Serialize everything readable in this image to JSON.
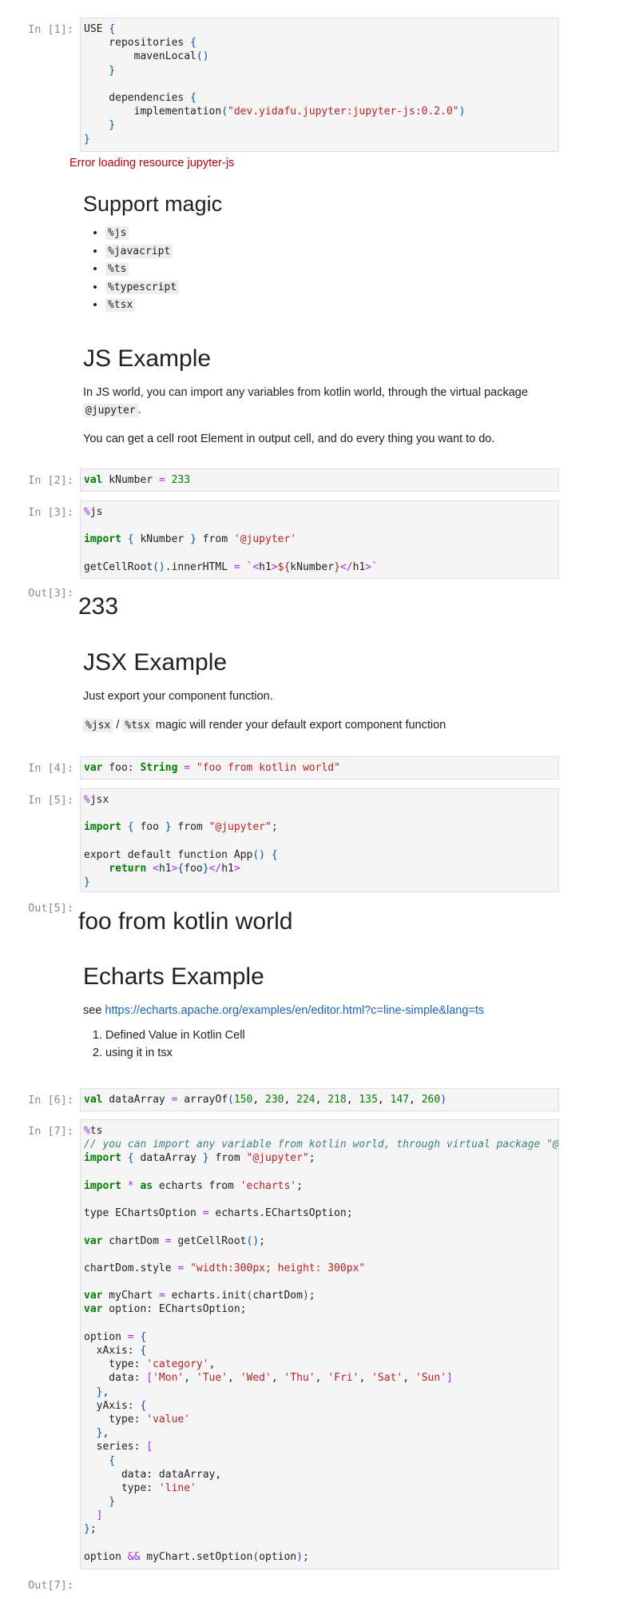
{
  "cells": {
    "c1": {
      "prompt": "In [1]:"
    },
    "c2": {
      "prompt": "In [2]:"
    },
    "c3": {
      "prompt": "In [3]:",
      "out_prompt": "Out[3]:",
      "output": "233"
    },
    "c4": {
      "prompt": "In [4]:"
    },
    "c5": {
      "prompt": "In [5]:",
      "out_prompt": "Out[5]:",
      "output": "foo from kotlin world"
    },
    "c6": {
      "prompt": "In [6]:"
    },
    "c7": {
      "prompt": "In [7]:",
      "out_prompt": "Out[7]:"
    }
  },
  "error_text": "Error loading resource jupyter-js",
  "support": {
    "heading": "Support magic",
    "items": [
      "%js",
      "%javacript",
      "%ts",
      "%typescript",
      "%tsx"
    ]
  },
  "js_example": {
    "heading": "JS Example",
    "p1_before": "In JS world, you can import any variables from kotlin world, through the virtual package",
    "p1_code": "@jupyter",
    "p1_after": ".",
    "p2": "You can get a cell root Element in output cell, and do every thing you want to do."
  },
  "jsx_example": {
    "heading": "JSX Example",
    "p1": "Just export your component function.",
    "p2_code1": "%jsx",
    "p2_sep": " / ",
    "p2_code2": "%tsx",
    "p2_after": " magic will render your default export component function"
  },
  "echarts_example": {
    "heading": "Echarts Example",
    "see": "see ",
    "link": "https://echarts.apache.org/examples/en/editor.html?c=line-simple&lang=ts",
    "steps": [
      "Defined Value in Kotlin Cell",
      "using it in tsx"
    ]
  },
  "code": {
    "c1": [
      [
        [
          "",
          "USE "
        ],
        [
          "br",
          "{"
        ]
      ],
      [
        [
          "",
          "    repositories "
        ],
        [
          "br",
          "{"
        ]
      ],
      [
        [
          "",
          "        mavenLocal"
        ],
        [
          "br",
          "()"
        ]
      ],
      [
        [
          "br",
          "    }"
        ]
      ],
      [
        [
          "",
          ""
        ]
      ],
      [
        [
          "",
          "    dependencies "
        ],
        [
          "br",
          "{"
        ]
      ],
      [
        [
          "",
          "        implementation"
        ],
        [
          "br",
          "("
        ],
        [
          "str",
          "\"dev.yidafu.jupyter:jupyter-js:0.2.0\""
        ],
        [
          "br",
          ")"
        ]
      ],
      [
        [
          "br",
          "    }"
        ]
      ],
      [
        [
          "br",
          "}"
        ]
      ]
    ],
    "c2": [
      [
        [
          "kw",
          "val"
        ],
        [
          "",
          " kNumber "
        ],
        [
          "op",
          "="
        ],
        [
          "",
          " "
        ],
        [
          "num",
          "233"
        ]
      ]
    ],
    "c3": [
      [
        [
          "op",
          "%"
        ],
        [
          "",
          "js"
        ]
      ],
      [
        [
          "",
          ""
        ]
      ],
      [
        [
          "kw",
          "import"
        ],
        [
          "",
          " "
        ],
        [
          "br",
          "{"
        ],
        [
          "",
          " kNumber "
        ],
        [
          "br",
          "}"
        ],
        [
          "",
          " from "
        ],
        [
          "str",
          "'@jupyter'"
        ]
      ],
      [
        [
          "",
          ""
        ]
      ],
      [
        [
          "",
          "getCellRoot"
        ],
        [
          "br",
          "()"
        ],
        [
          "",
          ".innerHTML "
        ],
        [
          "op",
          "="
        ],
        [
          "",
          " "
        ],
        [
          "str",
          "`"
        ],
        [
          "op",
          "<"
        ],
        [
          "",
          "h1"
        ],
        [
          "op",
          ">"
        ],
        [
          "str",
          "${"
        ],
        [
          "",
          "kNumber"
        ],
        [
          "str",
          "}"
        ],
        [
          "op",
          "</"
        ],
        [
          "",
          "h1"
        ],
        [
          "op",
          ">"
        ],
        [
          "str",
          "`"
        ]
      ]
    ],
    "c4": [
      [
        [
          "kw",
          "var"
        ],
        [
          "",
          " foo: "
        ],
        [
          "kw",
          "String"
        ],
        [
          "",
          " "
        ],
        [
          "op",
          "="
        ],
        [
          "",
          " "
        ],
        [
          "str",
          "\"foo from kotlin world\""
        ]
      ]
    ],
    "c5": [
      [
        [
          "op",
          "%"
        ],
        [
          "",
          "jsx"
        ]
      ],
      [
        [
          "",
          ""
        ]
      ],
      [
        [
          "kw",
          "import"
        ],
        [
          "",
          " "
        ],
        [
          "br",
          "{"
        ],
        [
          "",
          " foo "
        ],
        [
          "br",
          "}"
        ],
        [
          "",
          " from "
        ],
        [
          "str",
          "\"@jupyter\""
        ],
        [
          "",
          ";"
        ]
      ],
      [
        [
          "",
          ""
        ]
      ],
      [
        [
          "",
          "export default function App"
        ],
        [
          "br",
          "()"
        ],
        [
          "",
          " "
        ],
        [
          "br",
          "{"
        ]
      ],
      [
        [
          "",
          "    "
        ],
        [
          "kw",
          "return"
        ],
        [
          "",
          " "
        ],
        [
          "op",
          "<"
        ],
        [
          "",
          "h1"
        ],
        [
          "op",
          ">"
        ],
        [
          "br",
          "{"
        ],
        [
          "",
          "foo"
        ],
        [
          "br",
          "}"
        ],
        [
          "op",
          "</"
        ],
        [
          "",
          "h1"
        ],
        [
          "op",
          ">"
        ]
      ],
      [
        [
          "br",
          "}"
        ]
      ]
    ],
    "c6": [
      [
        [
          "kw",
          "val"
        ],
        [
          "",
          " dataArray "
        ],
        [
          "op",
          "="
        ],
        [
          "",
          " arrayOf"
        ],
        [
          "br",
          "("
        ],
        [
          "num",
          "150"
        ],
        [
          "",
          ", "
        ],
        [
          "num",
          "230"
        ],
        [
          "",
          ", "
        ],
        [
          "num",
          "224"
        ],
        [
          "",
          ", "
        ],
        [
          "num",
          "218"
        ],
        [
          "",
          ", "
        ],
        [
          "num",
          "135"
        ],
        [
          "",
          ", "
        ],
        [
          "num",
          "147"
        ],
        [
          "",
          ", "
        ],
        [
          "num",
          "260"
        ],
        [
          "br",
          ")"
        ]
      ]
    ],
    "c7": [
      [
        [
          "op",
          "%"
        ],
        [
          "",
          "ts"
        ]
      ],
      [
        [
          "cm",
          "// you can import any variable from kotlin world, through virtual package \"@ju"
        ]
      ],
      [
        [
          "kw",
          "import"
        ],
        [
          "",
          " "
        ],
        [
          "br",
          "{"
        ],
        [
          "",
          " dataArray "
        ],
        [
          "br",
          "}"
        ],
        [
          "",
          " from "
        ],
        [
          "str",
          "\"@jupyter\""
        ],
        [
          "",
          ";"
        ]
      ],
      [
        [
          "",
          ""
        ]
      ],
      [
        [
          "kw",
          "import"
        ],
        [
          "",
          " "
        ],
        [
          "op",
          "*"
        ],
        [
          "",
          " "
        ],
        [
          "kw",
          "as"
        ],
        [
          "",
          " echarts from "
        ],
        [
          "str",
          "'echarts'"
        ],
        [
          "",
          ";"
        ]
      ],
      [
        [
          "",
          ""
        ]
      ],
      [
        [
          "",
          "type EChartsOption "
        ],
        [
          "op",
          "="
        ],
        [
          "",
          " echarts.EChartsOption;"
        ]
      ],
      [
        [
          "",
          ""
        ]
      ],
      [
        [
          "kw",
          "var"
        ],
        [
          "",
          " chartDom "
        ],
        [
          "op",
          "="
        ],
        [
          "",
          " getCellRoot"
        ],
        [
          "br",
          "()"
        ],
        [
          "",
          ";"
        ]
      ],
      [
        [
          "",
          ""
        ]
      ],
      [
        [
          "",
          "chartDom.style "
        ],
        [
          "op",
          "="
        ],
        [
          "",
          " "
        ],
        [
          "str",
          "\"width:300px; height: 300px\""
        ]
      ],
      [
        [
          "",
          ""
        ]
      ],
      [
        [
          "kw",
          "var"
        ],
        [
          "",
          " myChart "
        ],
        [
          "op",
          "="
        ],
        [
          "",
          " echarts.init"
        ],
        [
          "br",
          "("
        ],
        [
          "",
          "chartDom"
        ],
        [
          "br",
          ")"
        ],
        [
          "",
          ";"
        ]
      ],
      [
        [
          "kw",
          "var"
        ],
        [
          "",
          " option: EChartsOption;"
        ]
      ],
      [
        [
          "",
          ""
        ]
      ],
      [
        [
          "",
          "option "
        ],
        [
          "op",
          "="
        ],
        [
          "",
          " "
        ],
        [
          "br",
          "{"
        ]
      ],
      [
        [
          "",
          "  xAxis: "
        ],
        [
          "br",
          "{"
        ]
      ],
      [
        [
          "",
          "    type: "
        ],
        [
          "str",
          "'category'"
        ],
        [
          "",
          ","
        ]
      ],
      [
        [
          "",
          "    data: "
        ],
        [
          "op",
          "["
        ],
        [
          "str",
          "'Mon'"
        ],
        [
          "",
          ", "
        ],
        [
          "str",
          "'Tue'"
        ],
        [
          "",
          ", "
        ],
        [
          "str",
          "'Wed'"
        ],
        [
          "",
          ", "
        ],
        [
          "str",
          "'Thu'"
        ],
        [
          "",
          ", "
        ],
        [
          "str",
          "'Fri'"
        ],
        [
          "",
          ", "
        ],
        [
          "str",
          "'Sat'"
        ],
        [
          "",
          ", "
        ],
        [
          "str",
          "'Sun'"
        ],
        [
          "op",
          "]"
        ]
      ],
      [
        [
          "br",
          "  }"
        ],
        [
          "",
          ","
        ]
      ],
      [
        [
          "",
          "  yAxis: "
        ],
        [
          "br",
          "{"
        ]
      ],
      [
        [
          "",
          "    type: "
        ],
        [
          "str",
          "'value'"
        ]
      ],
      [
        [
          "br",
          "  }"
        ],
        [
          "",
          ","
        ]
      ],
      [
        [
          "",
          "  series: "
        ],
        [
          "op",
          "["
        ]
      ],
      [
        [
          "br",
          "    {"
        ]
      ],
      [
        [
          "",
          "      data: dataArray,"
        ]
      ],
      [
        [
          "",
          "      type: "
        ],
        [
          "str",
          "'line'"
        ]
      ],
      [
        [
          "br",
          "    }"
        ]
      ],
      [
        [
          "op",
          "  ]"
        ]
      ],
      [
        [
          "br",
          "}"
        ],
        [
          "",
          ";"
        ]
      ],
      [
        [
          "",
          ""
        ]
      ],
      [
        [
          "",
          "option "
        ],
        [
          "op",
          "&&"
        ],
        [
          "",
          " myChart.setOption"
        ],
        [
          "br",
          "("
        ],
        [
          "",
          "option"
        ],
        [
          "br",
          ")"
        ],
        [
          "",
          ";"
        ]
      ]
    ]
  }
}
